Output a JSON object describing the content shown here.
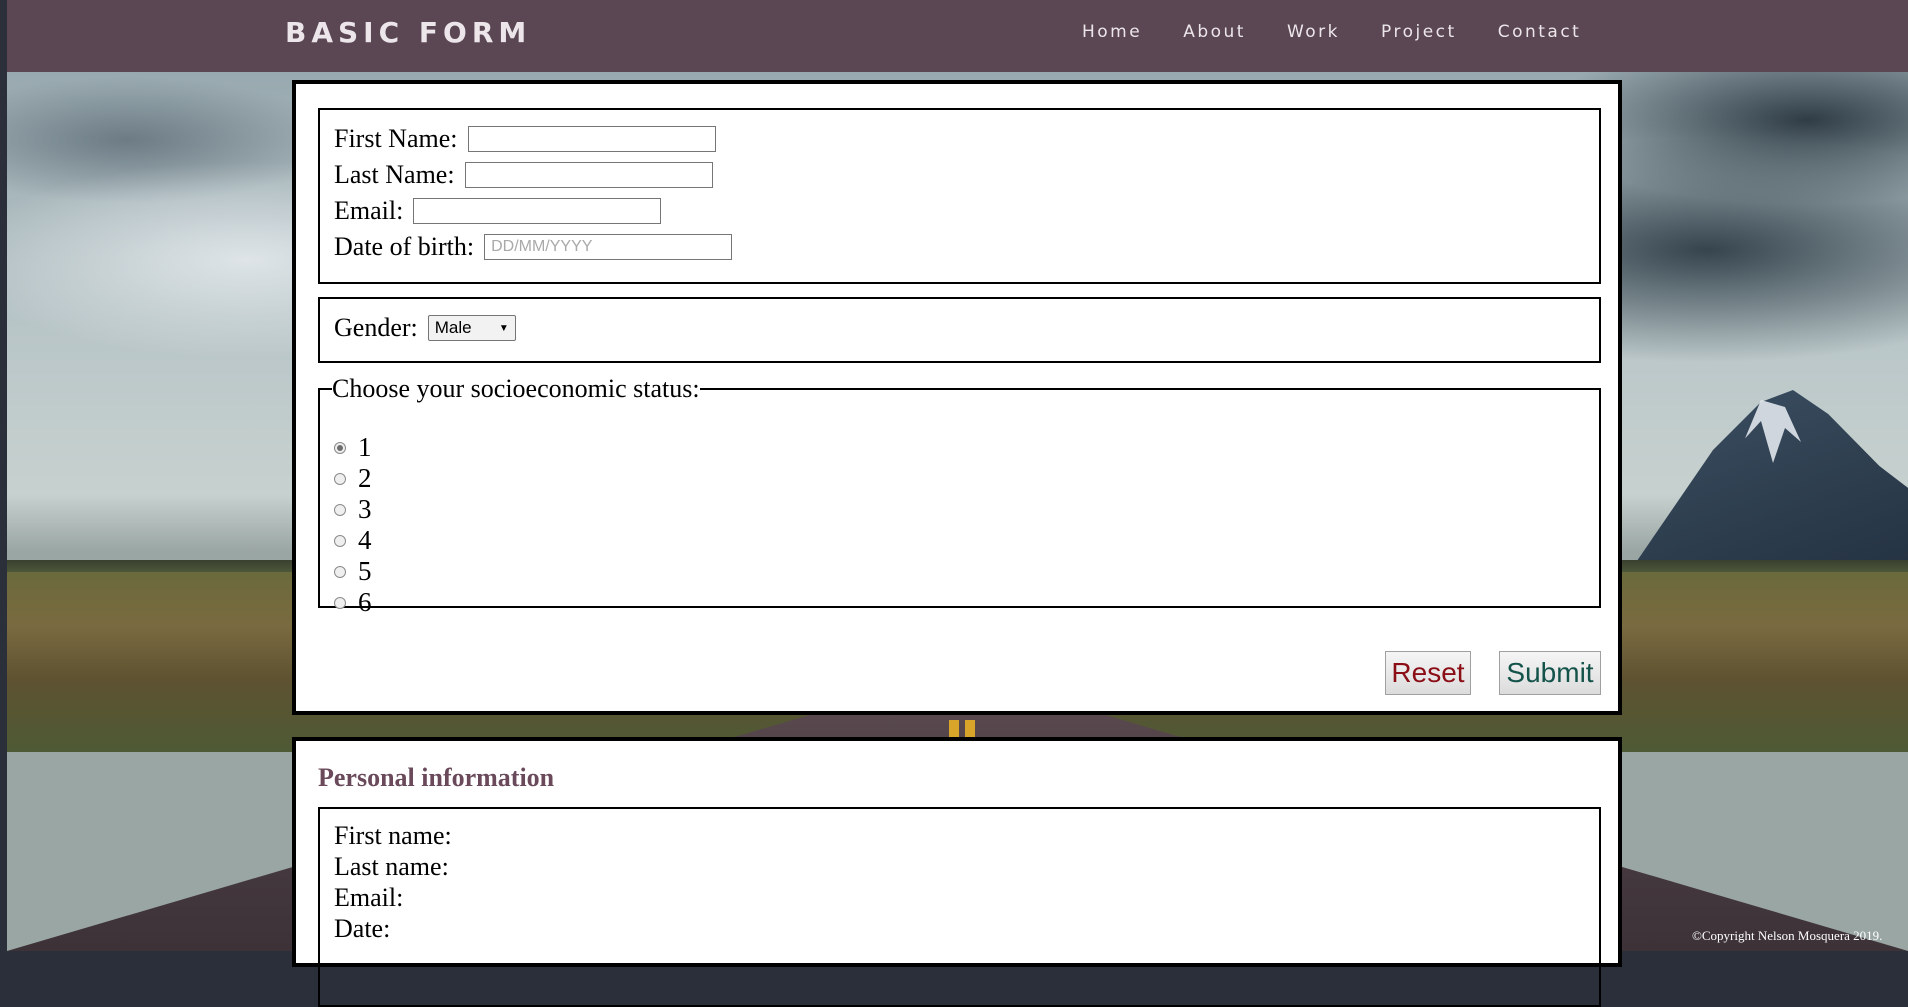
{
  "brand": "BASIC FORM",
  "nav": [
    "Home",
    "About",
    "Work",
    "Project",
    "Contact"
  ],
  "form": {
    "first_name_label": "First Name:",
    "last_name_label": "Last Name:",
    "email_label": "Email:",
    "dob_label": "Date of birth:",
    "dob_placeholder": "DD/MM/YYYY",
    "gender_label": "Gender:",
    "gender_value": "Male",
    "status_legend": "Choose your socioeconomic status:",
    "status_options": [
      "1",
      "2",
      "3",
      "4",
      "5",
      "6"
    ],
    "status_selected": "1",
    "reset_label": "Reset",
    "submit_label": "Submit"
  },
  "info": {
    "title": "Personal information",
    "first_name_label": "First name:",
    "last_name_label": "Last name:",
    "email_label": "Email:",
    "date_label": "Date:"
  },
  "copyright": "©Copyright Nelson Mosquera 2019.",
  "colors": {
    "nav_bg": "#5b4653",
    "reset_text": "#8b0e16",
    "submit_text": "#14534a",
    "info_title": "#6a4a5a"
  }
}
